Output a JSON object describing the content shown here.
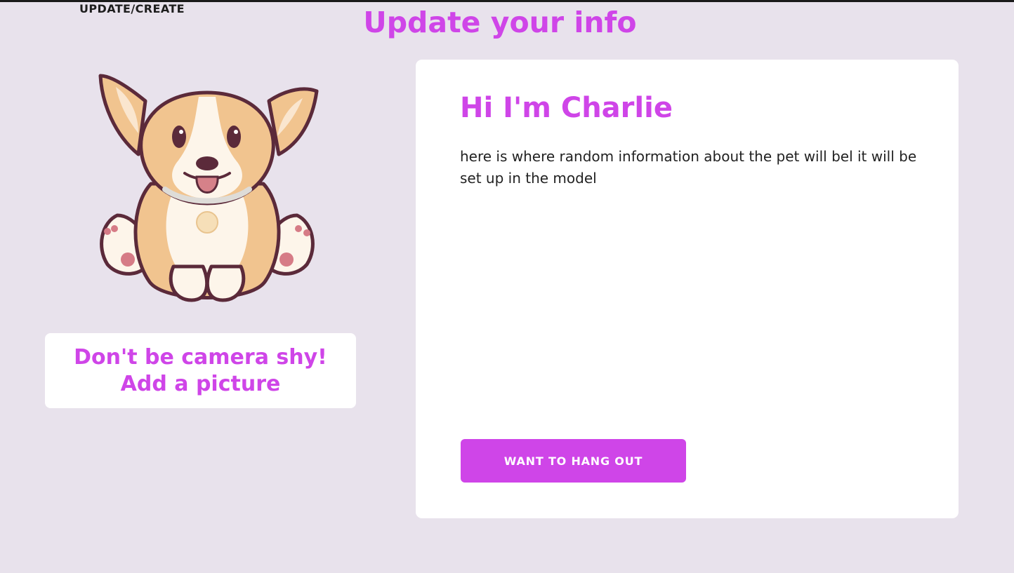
{
  "nav": {
    "label": "UPDATE/CREATE"
  },
  "page": {
    "title": "Update your info"
  },
  "picture_upload": {
    "line1": "Don't be camera shy!",
    "line2": "Add a picture"
  },
  "pet_card": {
    "heading": "Hi I'm Charlie",
    "description": "here is where random information about the pet will bel it will be set up in the model",
    "button_label": "WANT TO HANG OUT"
  },
  "pet_illustration": {
    "icon": "corgi-puppy-illustration"
  },
  "colors": {
    "background": "#e8e2ec",
    "accent": "#cf45e8",
    "card": "#ffffff",
    "text": "#222222"
  }
}
